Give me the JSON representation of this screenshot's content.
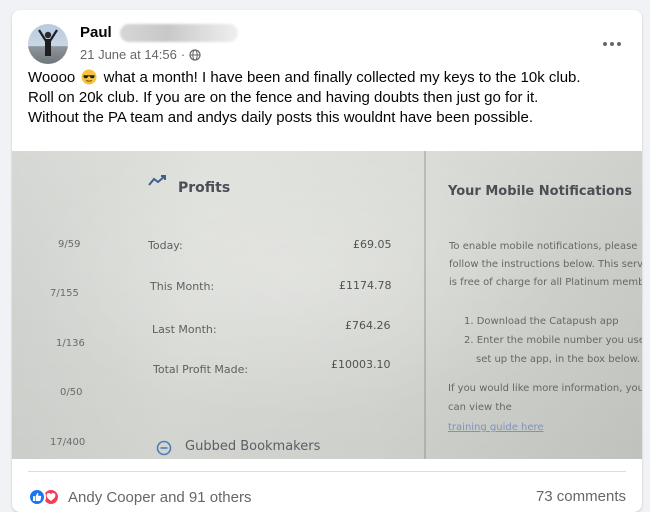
{
  "post": {
    "author": "Paul",
    "timestamp": "21 June at 14:56",
    "separator": "·",
    "audience_icon": "globe-icon",
    "text_lines": [
      {
        "before": "Woooo",
        "emoji": "sunglasses-emoji",
        "after": "what a month! I have been and finally collected my keys to the 10k club."
      },
      {
        "text": "Roll on 20k club. If you are on the fence and having doubts then just go for it."
      },
      {
        "text": "Without the PA team and andys daily posts this wouldnt have been possible."
      }
    ]
  },
  "screenshot": {
    "profits_title": "Profits",
    "rows": [
      {
        "label": "Today:",
        "value": "£69.05"
      },
      {
        "label": "This Month:",
        "value": "£1174.78"
      },
      {
        "label": "Last Month:",
        "value": "£764.26"
      },
      {
        "label": "Total Profit Made:",
        "value": "£10003.10"
      }
    ],
    "left_counts": [
      "9/59",
      "7/155",
      "1/136",
      "0/50",
      "17/400"
    ],
    "gubbed_title": "Gubbed Bookmakers",
    "notifications_title": "Your Mobile Notifications",
    "notification_lines": [
      "To enable mobile notifications, please",
      "follow the instructions below. This servi",
      "is free of charge for all Platinum membe",
      "1. Download the Catapush app",
      "2. Enter the mobile number you used",
      "set up the app, in the box below.",
      "If you would like more information, you",
      "can view the"
    ],
    "training_link": "training guide here"
  },
  "footer": {
    "reaction_icons": [
      "like-icon",
      "love-icon"
    ],
    "reactors": "Andy Cooper and 91 others",
    "comments": "73 comments"
  },
  "colors": {
    "like": "#1877f2",
    "love": "#f33e58",
    "secondary_text": "#65676b",
    "link": "#7f93b8"
  }
}
